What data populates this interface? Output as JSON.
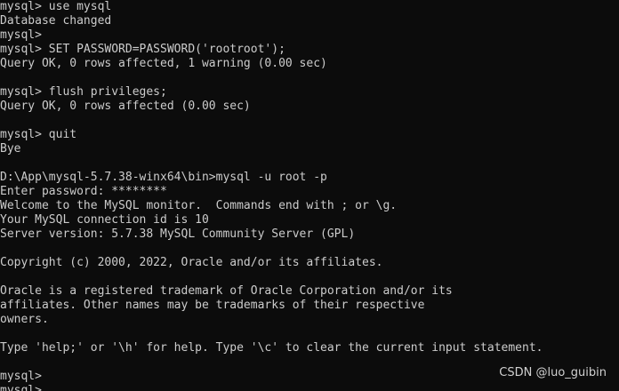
{
  "theme": {
    "background": "#0c0c0c",
    "foreground": "#cccccc"
  },
  "terminal": {
    "lines": [
      "mysql> use mysql",
      "Database changed",
      "mysql>",
      "mysql> SET PASSWORD=PASSWORD('rootroot');",
      "Query OK, 0 rows affected, 1 warning (0.00 sec)",
      "",
      "mysql> flush privileges;",
      "Query OK, 0 rows affected (0.00 sec)",
      "",
      "mysql> quit",
      "Bye",
      "",
      "D:\\App\\mysql-5.7.38-winx64\\bin>mysql -u root -p",
      "Enter password: ********",
      "Welcome to the MySQL monitor.  Commands end with ; or \\g.",
      "Your MySQL connection id is 10",
      "Server version: 5.7.38 MySQL Community Server (GPL)",
      "",
      "Copyright (c) 2000, 2022, Oracle and/or its affiliates.",
      "",
      "Oracle is a registered trademark of Oracle Corporation and/or its",
      "affiliates. Other names may be trademarks of their respective",
      "owners.",
      "",
      "Type 'help;' or '\\h' for help. Type '\\c' to clear the current input statement.",
      "",
      "mysql>",
      "mysql>"
    ]
  },
  "watermark": {
    "text": "CSDN @luo_guibin"
  }
}
